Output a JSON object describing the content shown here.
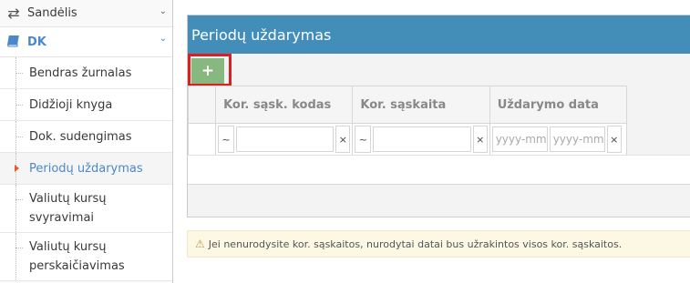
{
  "sidebar": {
    "group_sandelis": {
      "label": "Sandėlis",
      "icon": "exchange-icon"
    },
    "group_dk": {
      "label": "DK",
      "icon": "book-icon"
    },
    "items": [
      {
        "label": "Bendras žurnalas"
      },
      {
        "label": "Didžioji knyga"
      },
      {
        "label": "Dok. sudengimas"
      },
      {
        "label": "Periodų uždarymas",
        "active": true
      },
      {
        "label_line1": "Valiutų kursų",
        "label_line2": "svyravimai"
      },
      {
        "label_line1": "Valiutų kursų",
        "label_line2": "perskaičiavimas"
      }
    ]
  },
  "panel": {
    "title": "Periodų uždarymas",
    "add_label": "+",
    "columns": [
      "Kor. sąsk. kodas",
      "Kor. sąskaita",
      "Uždarymo data"
    ],
    "filters": {
      "op_symbol": "~",
      "clear_symbol": "×",
      "date_from_placeholder": "yyyy-mm",
      "date_to_placeholder": "yyyy-mm"
    }
  },
  "alert": {
    "text": "Jei nenurodysite kor. sąskaitos, nurodytai datai bus užrakintos visos kor. sąskaitos."
  },
  "colors": {
    "header_blue": "#438eb9",
    "add_green": "#87b87f",
    "highlight_red": "#dd1f1f",
    "active_link": "#4b88cb"
  }
}
